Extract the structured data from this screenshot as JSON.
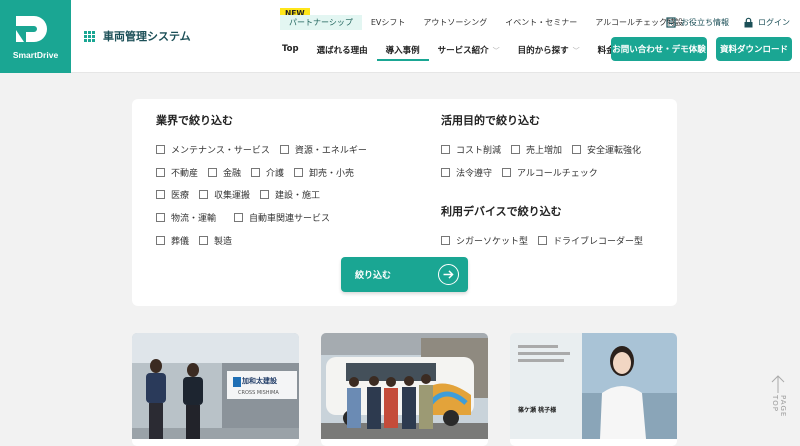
{
  "header": {
    "brand": "SmartDrive",
    "system_name": "車両管理システム",
    "new_badge": "NEW",
    "top_links": [
      "パートナーシップ",
      "EVシフト",
      "アウトソーシング",
      "イベント・セミナー",
      "アルコールチェック特設"
    ],
    "useful_info": "お役立ち情報",
    "login": "ログイン",
    "main_nav": [
      "Top",
      "選ばれる理由",
      "導入事例",
      "サービス紹介",
      "目的から探す",
      "料金"
    ],
    "active_nav": "導入事例",
    "contact_button": "お問い合わせ・デモ体験",
    "download_button": "資料ダウンロード"
  },
  "filter": {
    "industry_title": "業界で絞り込む",
    "industry_rows": [
      [
        "メンテナンス・サービス",
        "資源・エネルギー"
      ],
      [
        "不動産",
        "金融",
        "介護",
        "卸売・小売"
      ],
      [
        "医療",
        "収集運搬",
        "建設・施工"
      ],
      [
        "物流・運輸",
        "自動車関連サービス"
      ],
      [
        "葬儀",
        "製造"
      ]
    ],
    "purpose_title": "活用目的で絞り込む",
    "purpose_rows": [
      [
        "コスト削減",
        "売上増加",
        "安全運転強化"
      ],
      [
        "法令遵守",
        "アルコールチェック"
      ]
    ],
    "device_title": "利用デバイスで絞り込む",
    "device_rows": [
      [
        "シガーソケット型",
        "ドライブレコーダー型"
      ]
    ],
    "submit_label": "絞り込む"
  },
  "cards": [
    {
      "photo_caption": "加和太建設",
      "photo_caption_sub": "CROSS MISHIMA"
    },
    {
      "photo_caption": ""
    },
    {
      "photo_caption": "篠ケ瀬 桃子様"
    }
  ],
  "page_top": "PAGE TOP",
  "colors": {
    "accent": "#1aa693",
    "new_badge": "#ffe61a",
    "background": "#f2f2f2"
  }
}
